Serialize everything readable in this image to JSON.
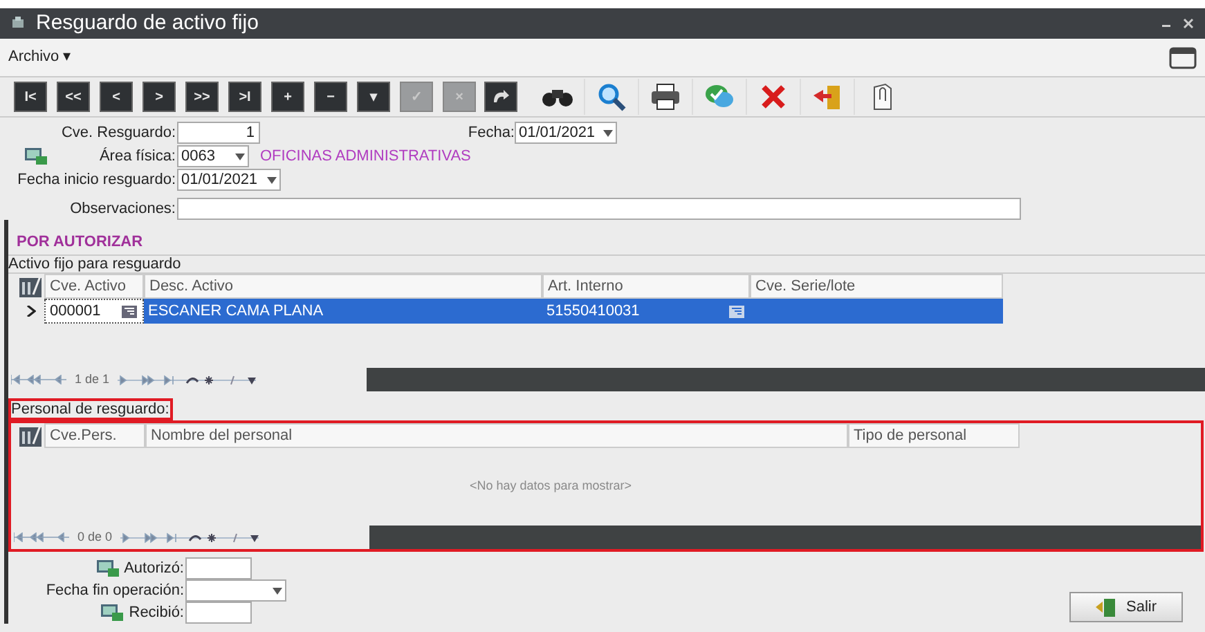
{
  "window": {
    "title": "Resguardo de activo fijo"
  },
  "menu": [
    {
      "label": "Archivo ▾"
    }
  ],
  "toolbar": [
    {
      "label": "I<",
      "disabled": false
    },
    {
      "label": "<<",
      "disabled": false
    },
    {
      "label": "<",
      "disabled": false
    },
    {
      "label": ">",
      "disabled": false
    },
    {
      "label": ">>",
      "disabled": false
    },
    {
      "label": ">I",
      "disabled": false
    },
    {
      "label": "+",
      "disabled": false
    },
    {
      "label": "−",
      "disabled": false
    },
    {
      "label": "▾",
      "disabled": false
    },
    {
      "label": "✓",
      "disabled": true
    },
    {
      "label": "×",
      "disabled": true
    }
  ],
  "form": {
    "cve_resguardo": {
      "label": "Cve. Resguardo:",
      "value": "1"
    },
    "fecha": {
      "label": "Fecha:",
      "value": "01/01/2021"
    },
    "area": {
      "label": "Área física:",
      "value": "0063",
      "description": "OFICINAS ADMINISTRATIVAS"
    },
    "fecha_inicio": {
      "label": "Fecha inicio resguardo:",
      "value": "01/01/2021"
    },
    "observaciones": {
      "label": "Observaciones:"
    }
  },
  "status": "POR AUTORIZAR",
  "assets": {
    "title": "Activo fijo para resguardo",
    "columns": [
      "Cve. Activo",
      "Desc. Activo",
      "Art. Interno",
      "Cve. Serie/lote"
    ],
    "rows": [
      {
        "cells": [
          "000001",
          "ESCANER CAMA PLANA",
          "51550410031",
          ""
        ],
        "selected": true
      }
    ],
    "pager": "1 de 1"
  },
  "personnel": {
    "title": "Personal de resguardo:",
    "columns": [
      "Cve.Pers.",
      "Nombre del personal",
      "Tipo de personal"
    ],
    "empty_message": "<No hay datos para mostrar>",
    "pager": "0 de 0"
  },
  "footer": {
    "autorizo": {
      "label": "Autorizó:"
    },
    "fecha_fin": {
      "label": "Fecha fin operación:"
    },
    "recibio": {
      "label": "Recibió:"
    }
  },
  "exit_button": {
    "label": "Salir"
  }
}
